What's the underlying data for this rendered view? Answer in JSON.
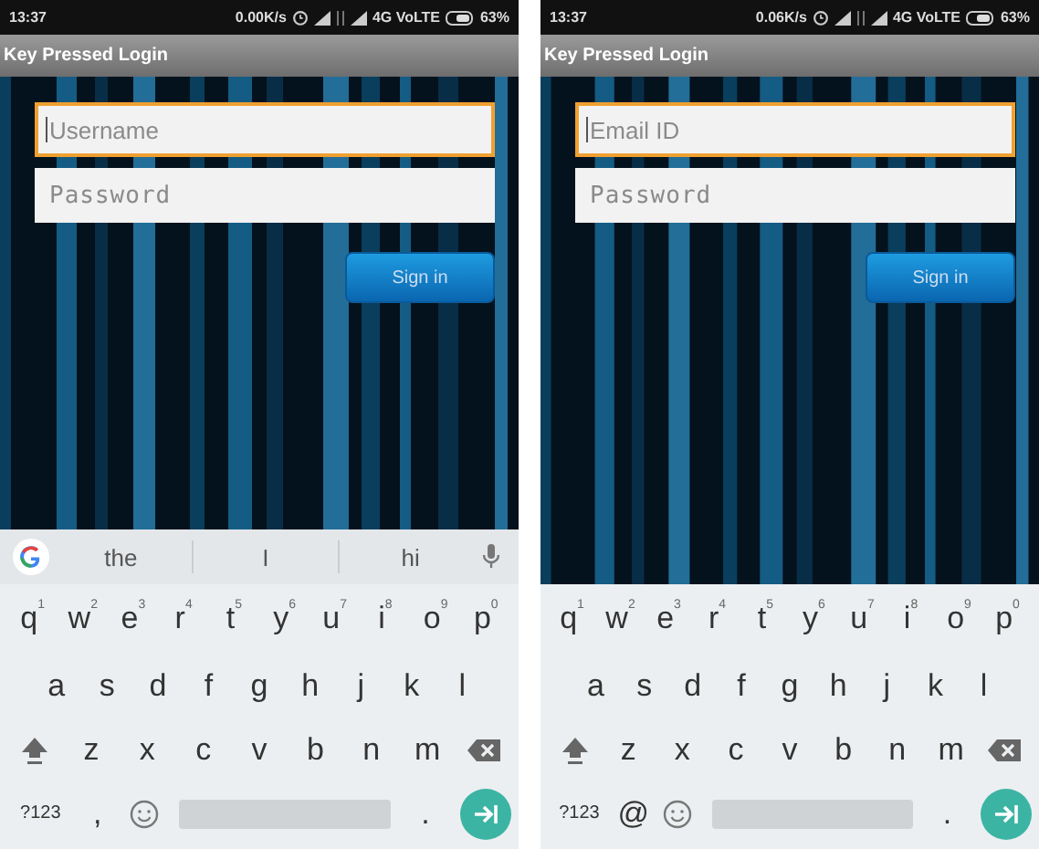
{
  "screens": [
    {
      "status_bar": {
        "time": "13:37",
        "speed": "0.00K/s",
        "network": "4G VoLTE",
        "battery": "63%"
      },
      "app_title": "Key Pressed Login",
      "fields": [
        {
          "placeholder": "Username",
          "focused": true
        },
        {
          "placeholder": "Password",
          "focused": false
        }
      ],
      "button": "Sign in",
      "suggestions": [
        "the",
        "I",
        "hi"
      ],
      "keyboard": [
        [
          {
            "kind": "letter",
            "label": "q",
            "hint": "1"
          },
          {
            "kind": "letter",
            "label": "w",
            "hint": "2"
          },
          {
            "kind": "letter",
            "label": "e",
            "hint": "3"
          },
          {
            "kind": "letter",
            "label": "r",
            "hint": "4"
          },
          {
            "kind": "letter",
            "label": "t",
            "hint": "5"
          },
          {
            "kind": "letter",
            "label": "y",
            "hint": "6"
          },
          {
            "kind": "letter",
            "label": "u",
            "hint": "7"
          },
          {
            "kind": "letter",
            "label": "i",
            "hint": "8"
          },
          {
            "kind": "letter",
            "label": "o",
            "hint": "9"
          },
          {
            "kind": "letter",
            "label": "p",
            "hint": "0"
          }
        ],
        [
          {
            "kind": "letter",
            "label": "a"
          },
          {
            "kind": "letter",
            "label": "s"
          },
          {
            "kind": "letter",
            "label": "d"
          },
          {
            "kind": "letter",
            "label": "f"
          },
          {
            "kind": "letter",
            "label": "g"
          },
          {
            "kind": "letter",
            "label": "h"
          },
          {
            "kind": "letter",
            "label": "j"
          },
          {
            "kind": "letter",
            "label": "k"
          },
          {
            "kind": "letter",
            "label": "l"
          }
        ],
        [
          {
            "kind": "shift"
          },
          {
            "kind": "letter",
            "label": "z"
          },
          {
            "kind": "letter",
            "label": "x"
          },
          {
            "kind": "letter",
            "label": "c"
          },
          {
            "kind": "letter",
            "label": "v"
          },
          {
            "kind": "letter",
            "label": "b"
          },
          {
            "kind": "letter",
            "label": "n"
          },
          {
            "kind": "letter",
            "label": "m"
          },
          {
            "kind": "backspace"
          }
        ],
        [
          {
            "kind": "small",
            "label": "?123"
          },
          {
            "kind": "letter",
            "label": ","
          },
          {
            "kind": "emoji"
          },
          {
            "kind": "space"
          },
          {
            "kind": "letter",
            "label": "."
          },
          {
            "kind": "enter"
          }
        ]
      ]
    },
    {
      "status_bar": {
        "time": "13:37",
        "speed": "0.06K/s",
        "network": "4G VoLTE",
        "battery": "63%"
      },
      "app_title": "Key Pressed Login",
      "fields": [
        {
          "placeholder": "Email ID",
          "focused": true
        },
        {
          "placeholder": "Password",
          "focused": false
        }
      ],
      "button": "Sign in",
      "keyboard": [
        [
          {
            "kind": "letter",
            "label": "q",
            "hint": "1"
          },
          {
            "kind": "letter",
            "label": "w",
            "hint": "2"
          },
          {
            "kind": "letter",
            "label": "e",
            "hint": "3"
          },
          {
            "kind": "letter",
            "label": "r",
            "hint": "4"
          },
          {
            "kind": "letter",
            "label": "t",
            "hint": "5"
          },
          {
            "kind": "letter",
            "label": "y",
            "hint": "6"
          },
          {
            "kind": "letter",
            "label": "u",
            "hint": "7"
          },
          {
            "kind": "letter",
            "label": "i",
            "hint": "8"
          },
          {
            "kind": "letter",
            "label": "o",
            "hint": "9"
          },
          {
            "kind": "letter",
            "label": "p",
            "hint": "0"
          }
        ],
        [
          {
            "kind": "letter",
            "label": "a"
          },
          {
            "kind": "letter",
            "label": "s"
          },
          {
            "kind": "letter",
            "label": "d"
          },
          {
            "kind": "letter",
            "label": "f"
          },
          {
            "kind": "letter",
            "label": "g"
          },
          {
            "kind": "letter",
            "label": "h"
          },
          {
            "kind": "letter",
            "label": "j"
          },
          {
            "kind": "letter",
            "label": "k"
          },
          {
            "kind": "letter",
            "label": "l"
          }
        ],
        [
          {
            "kind": "shift"
          },
          {
            "kind": "letter",
            "label": "z"
          },
          {
            "kind": "letter",
            "label": "x"
          },
          {
            "kind": "letter",
            "label": "c"
          },
          {
            "kind": "letter",
            "label": "v"
          },
          {
            "kind": "letter",
            "label": "b"
          },
          {
            "kind": "letter",
            "label": "n"
          },
          {
            "kind": "letter",
            "label": "m"
          },
          {
            "kind": "backspace"
          }
        ],
        [
          {
            "kind": "small",
            "label": "?123"
          },
          {
            "kind": "letter",
            "label": "@"
          },
          {
            "kind": "emoji"
          },
          {
            "kind": "space"
          },
          {
            "kind": "letter",
            "label": "."
          },
          {
            "kind": "enter"
          }
        ]
      ]
    }
  ]
}
